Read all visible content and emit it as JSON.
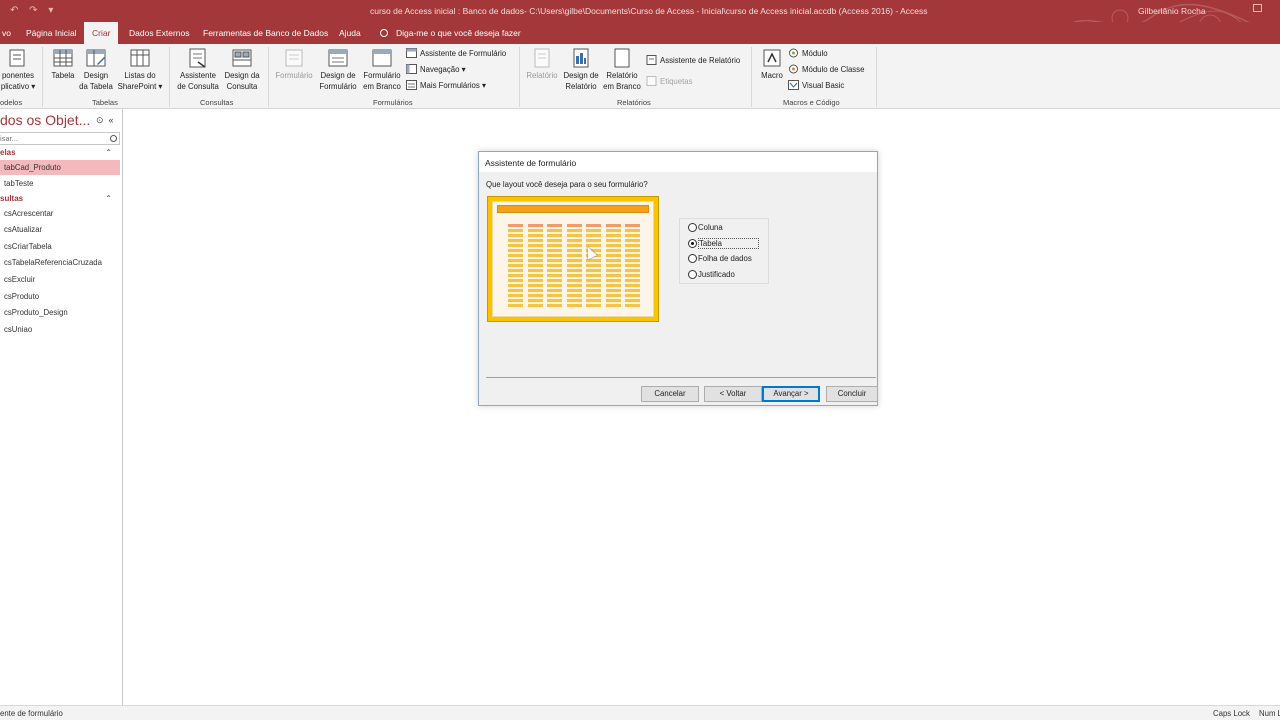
{
  "app": {
    "window_title": "curso de Access inicial : Banco de dados- C:\\Users\\gilbe\\Documents\\Curso de Access - Inicial\\curso de Access inicial.accdb (Access 2016)  -  Access",
    "user": "Gilberlânio Rocha",
    "accent_color": "#a4373a"
  },
  "tabs": {
    "items": [
      "vo",
      "Página Inicial",
      "Criar",
      "Dados Externos",
      "Ferramentas de Banco de Dados",
      "Ajuda"
    ],
    "active": "Criar",
    "tell_me": "Diga-me o que você deseja fazer"
  },
  "ribbon": {
    "modelos": {
      "btn_line1": "ponentes",
      "btn_line2": "plicativo",
      "label": "odelos"
    },
    "tabelas": {
      "tabela": "Tabela",
      "design_l1": "Design",
      "design_l2": "da Tabela",
      "listas_l1": "Listas do",
      "listas_l2": "SharePoint",
      "label": "Tabelas"
    },
    "consultas": {
      "assistente_l1": "Assistente",
      "assistente_l2": "de Consulta",
      "design_l1": "Design da",
      "design_l2": "Consulta",
      "label": "Consultas"
    },
    "formularios": {
      "formulario": "Formulário",
      "design_l1": "Design de",
      "design_l2": "Formulário",
      "branco_l1": "Formulário",
      "branco_l2": "em Branco",
      "assistente": "Assistente de Formulário",
      "navegacao": "Navegação",
      "mais": "Mais Formulários",
      "label": "Formulários"
    },
    "relatorios": {
      "relatorio": "Relatório",
      "design_l1": "Design de",
      "design_l2": "Relatório",
      "branco_l1": "Relatório",
      "branco_l2": "em Branco",
      "assistente": "Assistente de Relatório",
      "etiquetas": "Etiquetas",
      "label": "Relatórios"
    },
    "macros": {
      "macro": "Macro",
      "modulo": "Módulo",
      "modulo_classe": "Módulo de Classe",
      "visual_basic": "Visual Basic",
      "label": "Macros e Código"
    }
  },
  "nav": {
    "title": "dos os Objet...",
    "search_placeholder": "isar...",
    "groups": [
      {
        "name": "elas",
        "items": [
          "tabCad_Produto",
          "tabTeste"
        ]
      },
      {
        "name": "sultas",
        "items": [
          "csAcrescentar",
          "csAtualizar",
          "csCriarTabela",
          "csTabelaReferenciaCruzada",
          "csExcluir",
          "csProduto",
          "csProduto_Design",
          "csUniao"
        ]
      }
    ],
    "selected": "tabCad_Produto"
  },
  "dialog": {
    "title": "Assistente de formulário",
    "question": "Que layout você deseja para o seu formulário?",
    "options": [
      "Coluna",
      "Tabela",
      "Folha de dados",
      "Justificado"
    ],
    "selected": "Tabela",
    "buttons": {
      "cancel": "Cancelar",
      "back": "< Voltar",
      "next": "Avançar >",
      "finish": "Concluir"
    }
  },
  "status": {
    "left": "ente de formulário",
    "caps": "Caps Lock",
    "num": "Num L"
  }
}
